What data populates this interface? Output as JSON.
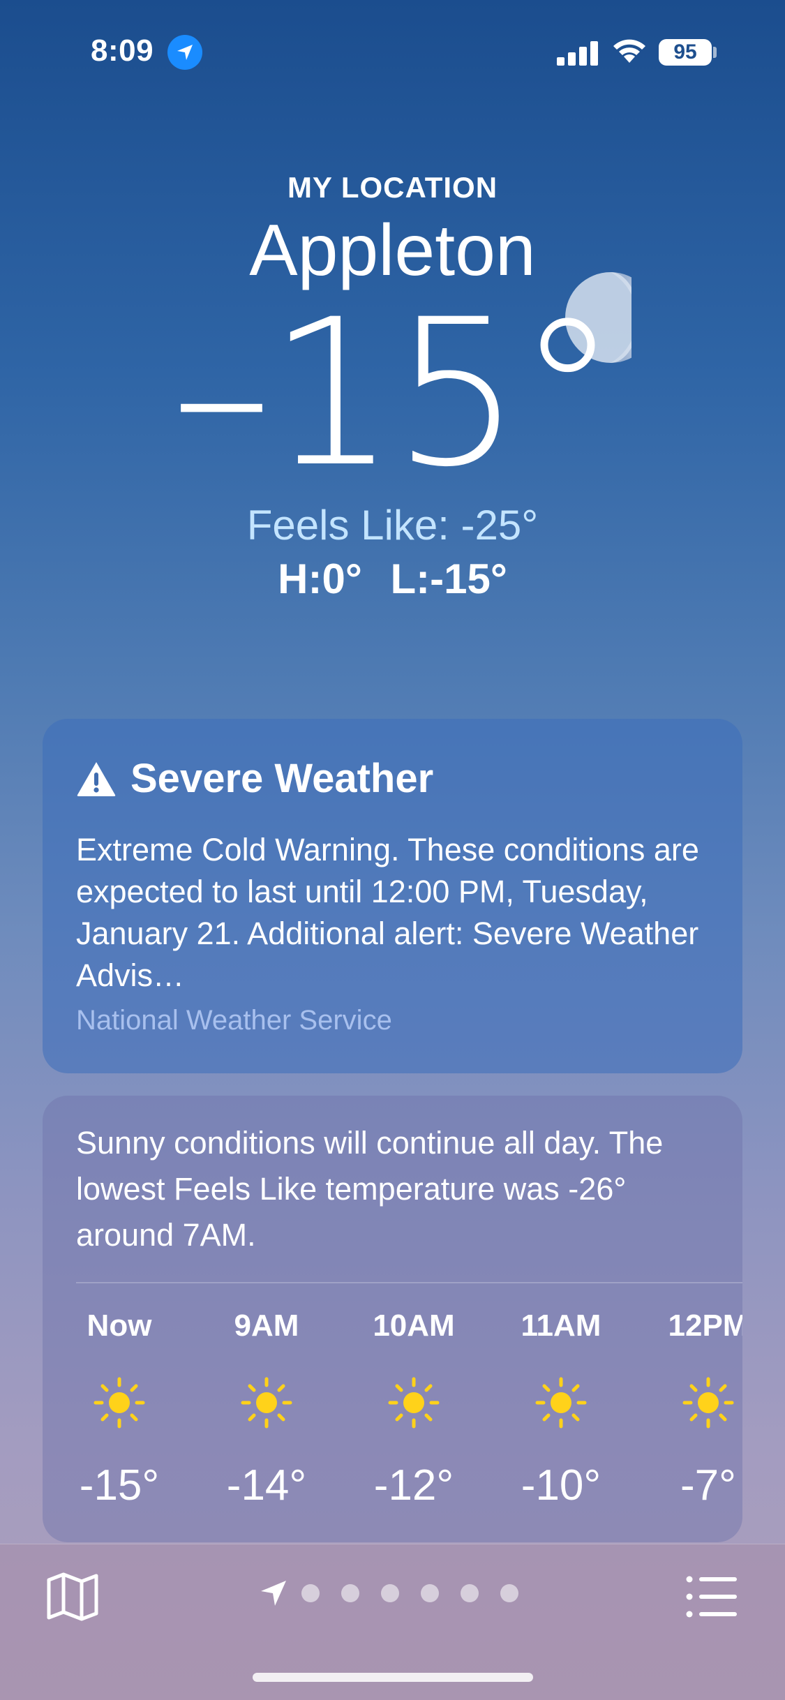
{
  "status_bar": {
    "time": "8:09",
    "battery": "95",
    "location_icon": "location-arrow-icon",
    "signal_icon": "cellular-signal-icon",
    "wifi_icon": "wifi-icon"
  },
  "hero": {
    "label": "MY LOCATION",
    "city": "Appleton",
    "temperature": "–15°",
    "feels_like": "Feels Like: -25°",
    "high": "H:0°",
    "low": "L:-15°",
    "moon_icon": "moon-icon"
  },
  "alert": {
    "icon": "warning-triangle-icon",
    "title": "Severe Weather",
    "body": "Extreme Cold Warning. These conditions are expected to last until 12:00 PM, Tuesday, January 21. Additional alert: Severe Weather Advis…",
    "source": "National Weather Service"
  },
  "forecast": {
    "summary": "Sunny conditions will continue all day. The lowest Feels Like temperature was -26° around 7AM.",
    "hours": [
      {
        "label": "Now",
        "icon": "sun-icon",
        "temp": "-15°"
      },
      {
        "label": "9AM",
        "icon": "sun-icon",
        "temp": "-14°"
      },
      {
        "label": "10AM",
        "icon": "sun-icon",
        "temp": "-12°"
      },
      {
        "label": "11AM",
        "icon": "sun-icon",
        "temp": "-10°"
      },
      {
        "label": "12PM",
        "icon": "sun-icon",
        "temp": "-7°"
      }
    ]
  },
  "bottom_bar": {
    "map_icon": "map-icon",
    "list_icon": "list-icon",
    "current_location_icon": "location-arrow-icon",
    "page_count": 6
  },
  "colors": {
    "feels_like": "#c3e4ff",
    "sun": "#ffd21a",
    "location_badge": "#1a8cff"
  }
}
